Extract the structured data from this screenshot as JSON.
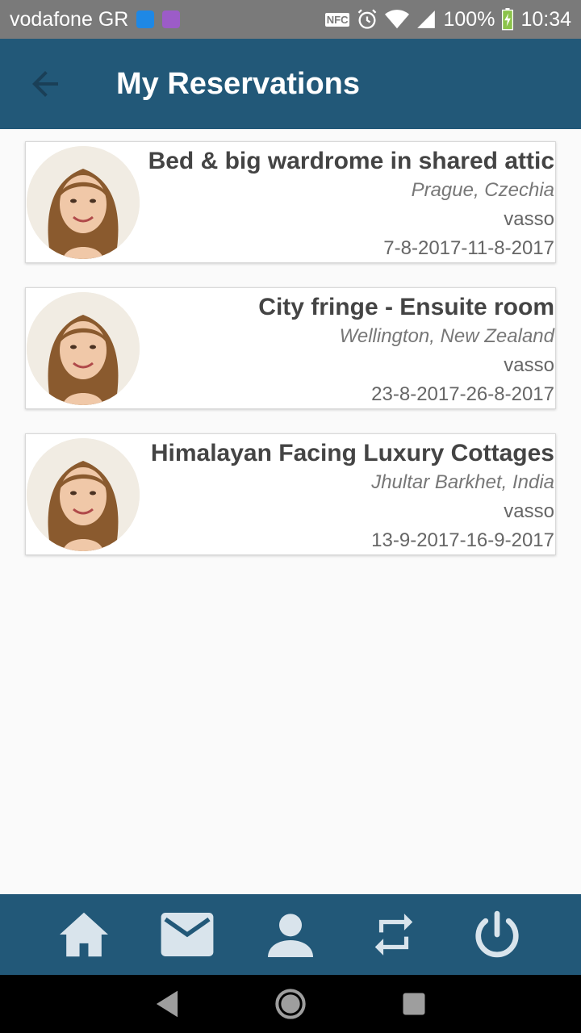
{
  "status_bar": {
    "carrier": "vodafone GR",
    "nfc": "NFC",
    "battery": "100%",
    "time": "10:34"
  },
  "app_bar": {
    "title": "My Reservations"
  },
  "reservations": [
    {
      "title": "Bed & big wardrome in shared attic",
      "location": "Prague, Czechia",
      "host": "vasso",
      "dates": "7-8-2017-11-8-2017"
    },
    {
      "title": "City fringe - Ensuite room",
      "location": "Wellington, New Zealand",
      "host": "vasso",
      "dates": "23-8-2017-26-8-2017"
    },
    {
      "title": "Himalayan Facing Luxury Cottages",
      "location": "Jhultar Barkhet, India",
      "host": "vasso",
      "dates": "13-9-2017-16-9-2017"
    }
  ],
  "bottom_nav": [
    "home-icon",
    "mail-icon",
    "person-icon",
    "repeat-icon",
    "power-icon"
  ],
  "colors": {
    "primary": "#225878",
    "status_bar": "#7a7a7a",
    "nav_icon": "#d9e4ec"
  }
}
